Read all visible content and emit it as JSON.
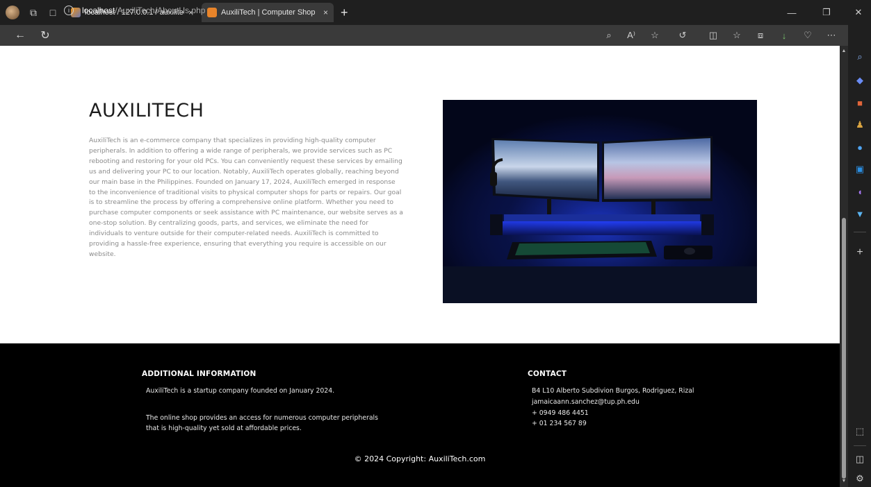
{
  "browser": {
    "tabs": [
      {
        "title": "localhost / 127.0.0.1 / auxilitech /",
        "close": "×"
      },
      {
        "title": "AuxiliTech | Computer Shop",
        "close": "×"
      }
    ],
    "new_tab_label": "+",
    "url_host": "localhost",
    "url_path": "/AuxiliTech/AboutUs.php"
  },
  "about": {
    "heading": "AUXILITECH",
    "body": "AuxiliTech is an e-commerce company that specializes in providing high-quality computer peripherals. In addition to offering a wide range of peripherals, we provide services such as PC rebooting and restoring for your old PCs. You can conveniently request these services by emailing us and delivering your PC to our location. Notably, AuxiliTech operates globally, reaching beyond our main base in the Philippines. Founded on January 17, 2024, AuxiliTech emerged in response to the inconvenience of traditional visits to physical computer shops for parts or repairs. Our goal is to streamline the process by offering a comprehensive online platform. Whether you need to purchase computer components or seek assistance with PC maintenance, our website serves as a one-stop solution. By centralizing goods, parts, and services, we eliminate the need for individuals to venture outside for their computer-related needs. AuxiliTech is committed to providing a hassle-free experience, ensuring that everything you require is accessible on our website."
  },
  "footer": {
    "additional_title": "ADDITIONAL INFORMATION",
    "additional_line1": "AuxiliTech is a startup company founded on January 2024.",
    "additional_line2a": "The online shop provides an access for numerous computer peripherals",
    "additional_line2b": "that is high-quality yet sold at affordable prices.",
    "contact_title": "CONTACT",
    "address": "B4 L10 Alberto Subdivion Burgos, Rodriguez, Rizal",
    "email": "jamaicaann.sanchez@tup.ph.edu",
    "phone1": "+ 0949 486 4451",
    "phone2": "+ 01 234 567 89",
    "copyright": "© 2024 Copyright: AuxiliTech.com"
  },
  "icons": {
    "profile": "profile-icon",
    "workspaces": "workspaces-icon",
    "tab_actions": "tab-actions-icon",
    "back": "back-arrow-icon",
    "refresh": "refresh-icon",
    "info": "site-info-icon",
    "zoom": "zoom-icon",
    "read_aloud": "read-aloud-icon",
    "favorite": "star-icon",
    "extensions": "extensions-icon",
    "split": "split-screen-icon",
    "favorites": "favorites-icon",
    "collections": "collections-icon",
    "downloads": "downloads-icon",
    "health": "browser-essentials-icon",
    "more": "more-icon",
    "copilot": "copilot-icon"
  },
  "colors": {
    "footer_bg": "#000000",
    "page_bg": "#ffffff",
    "body_text": "#8a8a8a",
    "heading": "#1d1d1d"
  }
}
